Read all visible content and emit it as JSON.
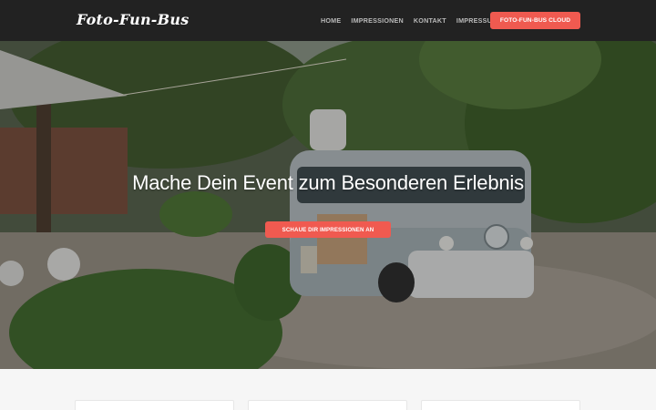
{
  "navbar": {
    "brand": "Foto-Fun-Bus",
    "links": [
      "HOME",
      "IMPRESSIONEN",
      "KONTAKT",
      "IMPRESSUM"
    ],
    "cta_label": "FOTO-FUN-BUS CLOUD"
  },
  "hero": {
    "title": "Mache Dein Event zum Besonderen Erlebnis",
    "button_label": "SCHAUE DIR IMPRESSIONEN AN"
  },
  "colors": {
    "accent": "#f05a50",
    "navbar_bg": "#222222",
    "page_bg": "#f6f6f6"
  }
}
